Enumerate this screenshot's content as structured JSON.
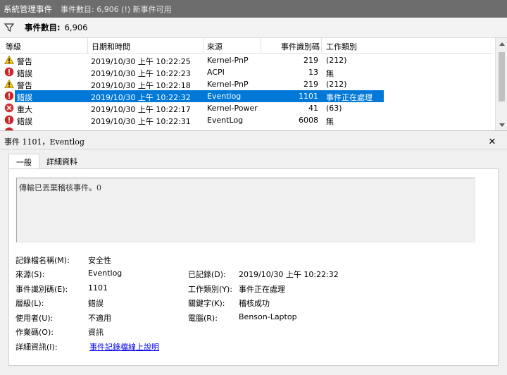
{
  "titlebar": {
    "title": "系統管理事件",
    "subtitle": "事件數目: 6,906 (!) 新事件可用"
  },
  "filterbar": {
    "label": "事件數目:",
    "value": "6,906"
  },
  "columns": [
    "等級",
    "日期和時間",
    "來源",
    "事件識別碼",
    "工作類別"
  ],
  "rows": [
    {
      "level": "警告",
      "icon": "warning-icon",
      "datetime": "2019/10/30 上午 10:22:25",
      "source": "Kernel-PnP",
      "id": "219",
      "category": "(212)",
      "selected": false
    },
    {
      "level": "錯誤",
      "icon": "error-icon",
      "datetime": "2019/10/30 上午 10:22:23",
      "source": "ACPI",
      "id": "13",
      "category": "無",
      "selected": false
    },
    {
      "level": "警告",
      "icon": "warning-icon",
      "datetime": "2019/10/30 上午 10:22:18",
      "source": "Kernel-PnP",
      "id": "219",
      "category": "(212)",
      "selected": false
    },
    {
      "level": "錯誤",
      "icon": "error-icon",
      "datetime": "2019/10/30 上午 10:22:32",
      "source": "Eventlog",
      "id": "1101",
      "category": "事件正在處理",
      "selected": true
    },
    {
      "level": "重大",
      "icon": "critical-icon",
      "datetime": "2019/10/30 上午 10:22:17",
      "source": "Kernel-Power",
      "id": "41",
      "category": "(63)",
      "selected": false
    },
    {
      "level": "錯誤",
      "icon": "error-icon",
      "datetime": "2019/10/30 上午 10:22:31",
      "source": "EventLog",
      "id": "6008",
      "category": "無",
      "selected": false
    }
  ],
  "detail": {
    "header": "事件 1101，Eventlog",
    "tabs": [
      "一般",
      "詳細資料"
    ],
    "message": "傳輸已丟棄稽核事件。0",
    "fields": {
      "log_name_label": "記錄檔名稱(M):",
      "log_name": "安全性",
      "source_label": "來源(S):",
      "source": "Eventlog",
      "logged_label": "已記錄(D):",
      "logged": "2019/10/30 上午 10:22:32",
      "event_id_label": "事件識別碼(E):",
      "event_id": "1101",
      "task_category_label": "工作類別(Y):",
      "task_category": "事件正在處理",
      "level_label": "層級(L):",
      "level": "錯誤",
      "keywords_label": "關鍵字(K):",
      "keywords": "稽核成功",
      "user_label": "使用者(U):",
      "user": "不適用",
      "computer_label": "電腦(R):",
      "computer": "Benson-Laptop",
      "opcode_label": "作業碼(O):",
      "opcode": "資訊",
      "more_info_label": "詳細資訊(I):",
      "more_info_link": "事件記錄檔線上說明"
    }
  },
  "colors": {
    "selected": "#0078d7",
    "title_bg": "#6d6d6d",
    "link": "#0000ee"
  }
}
